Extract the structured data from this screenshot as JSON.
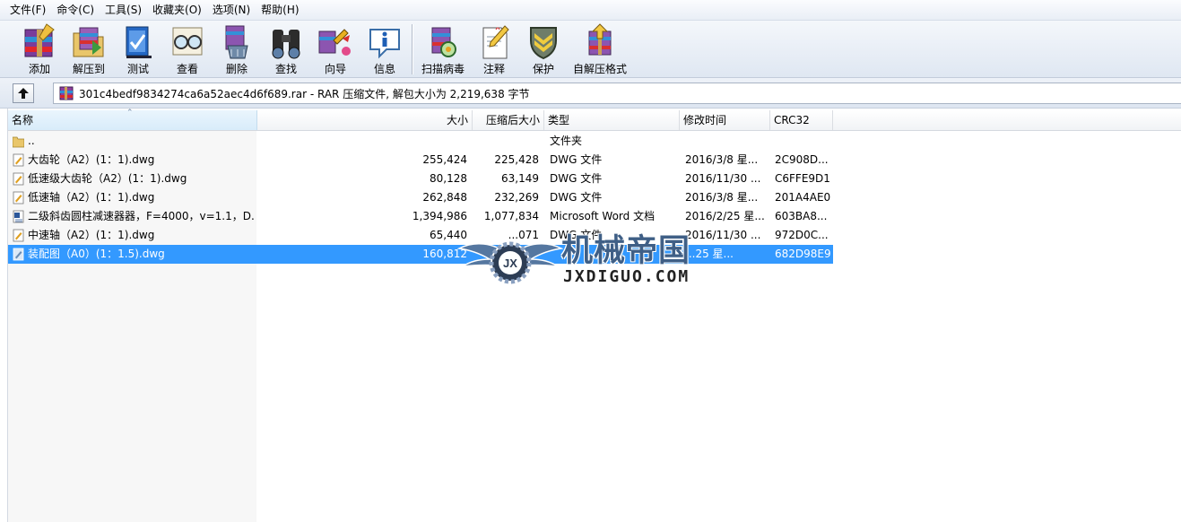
{
  "menu": [
    "文件(F)",
    "命令(C)",
    "工具(S)",
    "收藏夹(O)",
    "选项(N)",
    "帮助(H)"
  ],
  "toolbar": {
    "add": "添加",
    "extract_to": "解压到",
    "test": "测试",
    "view": "查看",
    "delete": "删除",
    "find": "查找",
    "wizard": "向导",
    "info": "信息",
    "virus_scan": "扫描病毒",
    "comment": "注释",
    "protect": "保护",
    "sfx": "自解压格式"
  },
  "address": {
    "text": "301c4bedf9834274ca6a52aec4d6f689.rar - RAR 压缩文件, 解包大小为 2,219,638 字节"
  },
  "columns": {
    "name": "名称",
    "size": "大小",
    "packed": "压缩后大小",
    "type": "类型",
    "modified": "修改时间",
    "crc": "CRC32"
  },
  "files": [
    {
      "name": "..",
      "size": "",
      "packed": "",
      "type": "文件夹",
      "modified": "",
      "crc": "",
      "icon": "folder-icon"
    },
    {
      "name": "大齿轮（A2）(1：1).dwg",
      "size": "255,424",
      "packed": "225,428",
      "type": "DWG 文件",
      "modified": "2016/3/8 星...",
      "crc": "2C908D...",
      "icon": "dwg-file-icon"
    },
    {
      "name": "低速级大齿轮（A2）(1：1).dwg",
      "size": "80,128",
      "packed": "63,149",
      "type": "DWG 文件",
      "modified": "2016/11/30 ...",
      "crc": "C6FFE9D1",
      "icon": "dwg-file-icon"
    },
    {
      "name": "低速轴（A2）(1：1).dwg",
      "size": "262,848",
      "packed": "232,269",
      "type": "DWG 文件",
      "modified": "2016/3/8 星...",
      "crc": "201A4AE0",
      "icon": "dwg-file-icon"
    },
    {
      "name": "二级斜齿圆柱减速器器，F=4000，v=1.1，D...",
      "size": "1,394,986",
      "packed": "1,077,834",
      "type": "Microsoft Word 文档",
      "modified": "2016/2/25 星...",
      "crc": "603BA8...",
      "icon": "word-file-icon"
    },
    {
      "name": "中速轴（A2）(1：1).dwg",
      "size": "65,440",
      "packed": "...071",
      "type": "DWG 文件",
      "modified": "2016/11/30 ...",
      "crc": "972D0C...",
      "icon": "dwg-file-icon"
    },
    {
      "name": "装配图（A0）(1：1.5).dwg",
      "size": "160,812",
      "packed": "",
      "type": "",
      "modified": "...25 星...",
      "crc": "682D98E9",
      "icon": "dwg-file-icon",
      "selected": true
    }
  ],
  "watermark": {
    "cn": "机械帝国",
    "en": "JXDIGUO.COM",
    "emblem": "JX"
  },
  "colors": {
    "selection": "#3399ff",
    "watermark_blue": "#3f5f86"
  }
}
